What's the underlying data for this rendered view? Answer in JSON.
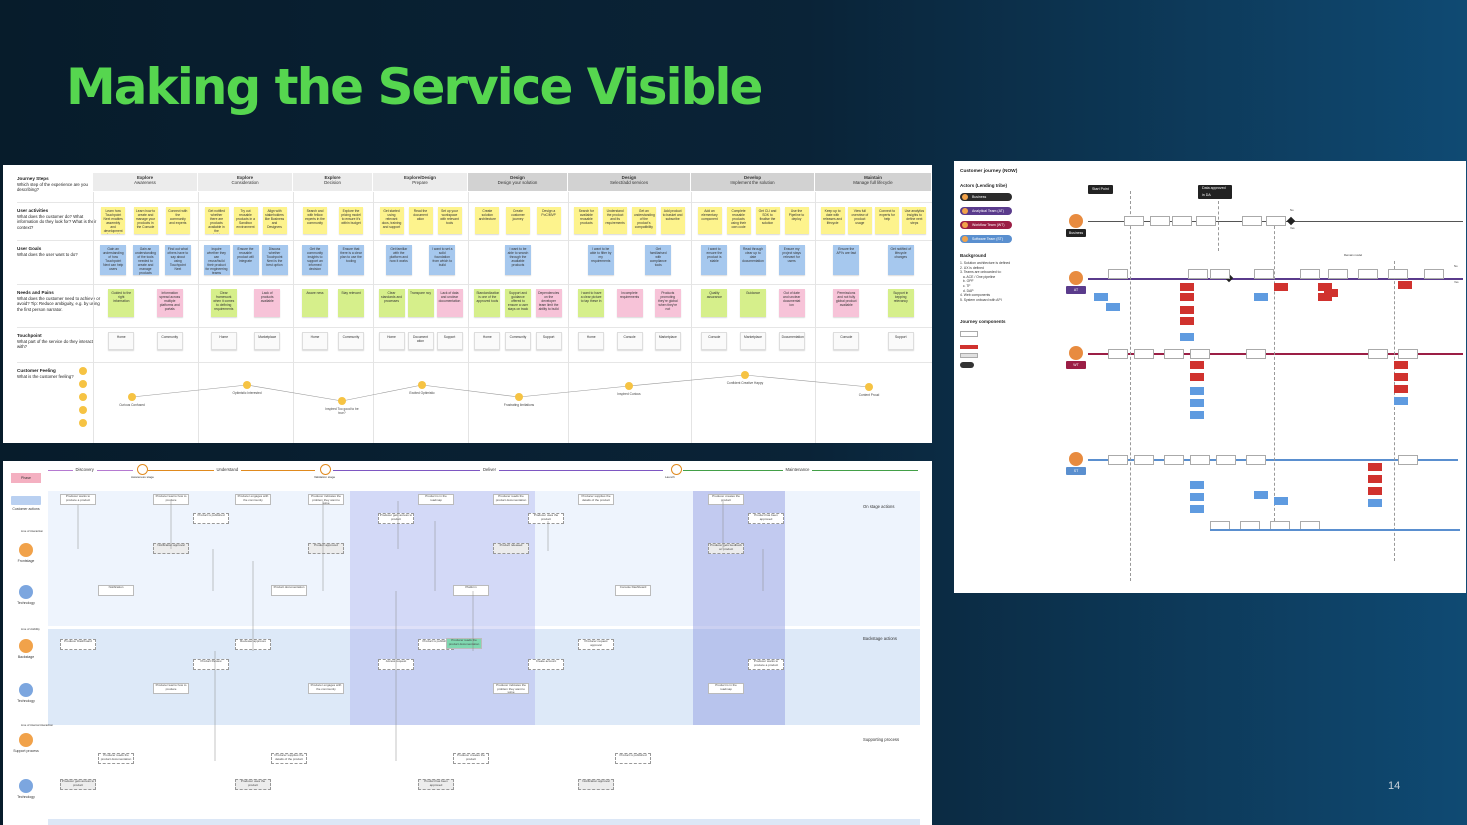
{
  "slide": {
    "title": "Making the Service Visible",
    "page_number": "14"
  },
  "journey_map": {
    "row_labels": [
      {
        "title": "Journey Steps",
        "desc": "Which step of the experience are you describing?"
      },
      {
        "title": "User activities",
        "desc": "What does the customer do? What information do they look for? What is their context?"
      },
      {
        "title": "User Goals",
        "desc": "What does the user want to do?"
      },
      {
        "title": "Needs and Pains",
        "desc": "What does the customer need to achieve or avoid? Tip: Reduce ambiguity, e.g. by using the first person narrator."
      },
      {
        "title": "Touchpoint",
        "desc": "What part of the service do they interact with?"
      },
      {
        "title": "Customer Feeling",
        "desc": "What is the customer feeling?"
      }
    ],
    "stages": [
      {
        "name": "Explore",
        "sub": "Awareness"
      },
      {
        "name": "Explore",
        "sub": "Consideration"
      },
      {
        "name": "Explore",
        "sub": "Decision"
      },
      {
        "name": "Explore/Design",
        "sub": "Prepare"
      },
      {
        "name": "Design",
        "sub": "Design your solution"
      },
      {
        "name": "Design",
        "sub": "Select/add services"
      },
      {
        "name": "Develop",
        "sub": "Implement the solution"
      },
      {
        "name": "Maintain",
        "sub": "Manage full lifecycle"
      }
    ],
    "activities": [
      "Learn how Touchpoint Next enables assembly and development of reusable products",
      "Learn how to create and manage your products in the Console",
      "Connect with the community and experts",
      "Get notified whether there are products available in the marketplace",
      "Try out reusable products in a Sandbox environment",
      "Align with stakeholders like Business and Designers",
      "Search and with fellow experts in the community",
      "Explore the pricing model to ensure it's within budget",
      "Get started using relevant docs, training and support",
      "Read the document ation",
      "Set up your workspace with relevant tools",
      "Create solution architecture",
      "Create customer journey",
      "Design a PoC/MVP",
      "Search for available reusable products",
      "Understand the product and its requirements",
      "Get an understanding of the product's compatibility",
      "Add product to basket and subscribe",
      "Add an elementary component",
      "Complete reusable products using their own code",
      "Get CLI and SDK to finalise the solution",
      "Use the Pipeline to deploy",
      "Keep up to date with releases and lifecycle",
      "View full overview of product usage",
      "Connect to experts for help",
      "Use analytics insights to define next steps"
    ],
    "goals": [
      "Gain an understanding of how Touchpoint Next can help users",
      "Gain an understanding of the tools needed to create and manage products",
      "Find out what others have to say about using Touchpoint Next",
      "Inquire whether they can reuse/build their product for engineering teams",
      "Ensure the reusable product will integrate",
      "Discuss whether Touchpoint Next is the best option",
      "Get the community insights to support an informed decision",
      "Ensure that there is a clear plan to use the tooling",
      "Get familiar with the platform and how it works",
      "I want to set a solid foundation from which to build",
      "I want to be able to search through the available products",
      "I want to be able to filter by my requirements",
      "Get familiarised with compliance tools",
      "I want to ensure the product is stable",
      "Read through clear up to date documentation",
      "Ensure my project stays relevant for users",
      "Ensure the API's are fast",
      "Get notified of lifecycle changes"
    ],
    "needs": [
      {
        "text": "Guided to the right information",
        "color": "green"
      },
      {
        "text": "Information spread across multiple platforms and portals",
        "color": "pink"
      },
      {
        "text": "Clear framework when it comes to defining requirements",
        "color": "green"
      },
      {
        "text": "Lack of products available",
        "color": "pink"
      },
      {
        "text": "Aware ness",
        "color": "green"
      },
      {
        "text": "Stay relevant",
        "color": "green"
      },
      {
        "text": "Clear standards and processes",
        "color": "green"
      },
      {
        "text": "Transpare ncy",
        "color": "green"
      },
      {
        "text": "Lack of data and unclear documentation",
        "color": "pink"
      },
      {
        "text": "Standardization is one of the approved tools",
        "color": "green"
      },
      {
        "text": "Support and guidance offered to ensure a user stays on track",
        "color": "green"
      },
      {
        "text": "Dependencies on the developer team limit the ability to build",
        "color": "pink"
      },
      {
        "text": "I want to have a clear picture to tap these in",
        "color": "green"
      },
      {
        "text": "Incomplete requirements",
        "color": "pink"
      },
      {
        "text": "Products promoting they're global when they're not",
        "color": "pink"
      },
      {
        "text": "Quality assurance",
        "color": "green"
      },
      {
        "text": "Guidance",
        "color": "green"
      },
      {
        "text": "Out of date and unclear documentat ion",
        "color": "pink"
      },
      {
        "text": "Permissions and not fully global product available",
        "color": "pink"
      },
      {
        "text": "Support in kepping relevancy",
        "color": "green"
      }
    ],
    "touchpoints": [
      "Home",
      "Community",
      "Home",
      "Marketplace",
      "Home",
      "Community",
      "Home",
      "Document ation",
      "Support",
      "Home",
      "Community",
      "Support",
      "Home",
      "Console",
      "Marketplace",
      "Console",
      "Marketplace",
      "Documentation",
      "Console",
      "Support"
    ],
    "feelings": [
      {
        "text": "Curious Confused"
      },
      {
        "text": "Optimistic Interested"
      },
      {
        "text": "Inspired Too good to be true?"
      },
      {
        "text": "Excited Optimistic"
      },
      {
        "text": "Frustrating limitations"
      },
      {
        "text": "Inspired Curious"
      },
      {
        "text": "Confident Creative Happy"
      },
      {
        "text": "Content Proud"
      }
    ]
  },
  "blueprint": {
    "phase_label": "Phase",
    "phases": [
      "Discovery",
      "Understand",
      "Deliver",
      "Maintenance"
    ],
    "milestones": [
      "Awareness stage",
      "Validation stage",
      "Launch"
    ],
    "sections": [
      "On stage actions",
      "Backstage actions",
      "Supporting process"
    ],
    "lanes": [
      {
        "name": "Customer actions"
      },
      {
        "name": "Frontstage"
      },
      {
        "name": "Technology"
      },
      {
        "name": "Backstage"
      },
      {
        "name": "Technology"
      },
      {
        "name": "Support process"
      },
      {
        "name": "Technology"
      }
    ],
    "line_labels": [
      "Line of interaction",
      "Line of visibility",
      "Line of internal interaction"
    ],
    "cards": [
      "Producer wants to produce a product",
      "Producer learns how to produce",
      "Producer engages with the community",
      "Producer indicates the problem they want to solve",
      "Product is in the roadmap",
      "Producer reads the product documentation",
      "Producer supplies the details of the product",
      "Producer creates the product",
      "Product is published",
      "Producer gets access to product",
      "Producer uses the product",
      "Product has been approved",
      "Notification approval",
      "Product approved",
      "Product released",
      "Producer gets feedback on product",
      "Notification",
      "Product documentation",
      "Platform",
      "Console Dashboard",
      "Producer Dashboard",
      "Reviewer approves",
      "Product is published",
      "Producer request approval",
      "Product Review",
      "Access request",
      "Create account"
    ]
  },
  "customer_journey_now": {
    "title": "Customer journey (NOW)",
    "actors_heading": "Actors (Lending tribe)",
    "actors": [
      {
        "name": "Business",
        "color": "#2b2b2b"
      },
      {
        "name": "Analytical Team (AT)",
        "color": "#5a3b8c"
      },
      {
        "name": "Workflow Team (WT)",
        "color": "#9b1e45"
      },
      {
        "name": "Software Team (ST)",
        "color": "#5a8fcf"
      }
    ],
    "background_heading": "Background",
    "background_items": "1. Solution architecture is defined\n2. UX is defined\n3. Teams are onboarded to:\n   a. ACE / One pipeline\n   b. OPF\n   c. TF\n   d. DAP\n4. Web components\n5. System onboard with API",
    "components_heading": "Journey components",
    "start_label": "Start Point",
    "approved_label": "Data approved in DA",
    "remain_label": "Remain model",
    "personas": [
      "Business",
      "AT",
      "WT",
      "ST"
    ],
    "yes": "Yes",
    "no": "No"
  }
}
